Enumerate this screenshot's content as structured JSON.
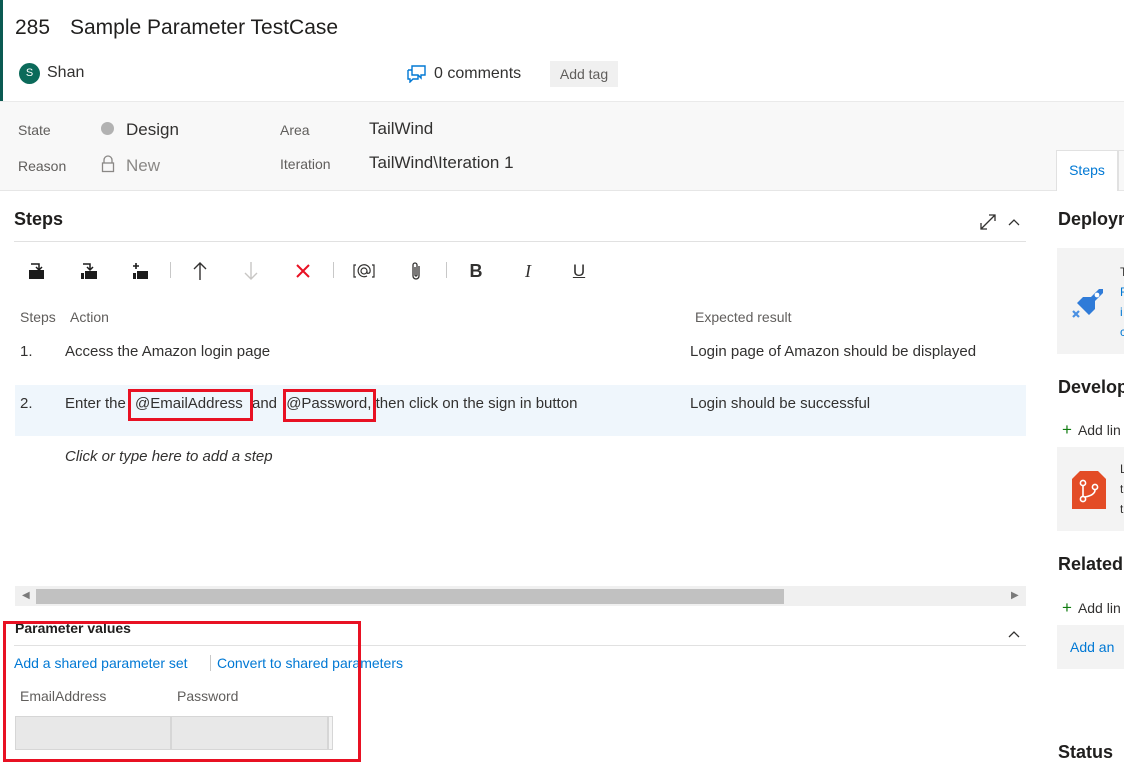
{
  "header": {
    "work_item_id": "285",
    "title": "Sample Parameter TestCase",
    "avatar_initial": "S",
    "assignee": "Shan",
    "comments": "0 comments",
    "add_tag": "Add tag"
  },
  "fields": {
    "state_label": "State",
    "state_value": "Design",
    "reason_label": "Reason",
    "reason_value": "New",
    "area_label": "Area",
    "area_value": "TailWind",
    "iteration_label": "Iteration",
    "iteration_value": "TailWind\\Iteration 1"
  },
  "right_tabs": {
    "active": "Steps"
  },
  "steps": {
    "title": "Steps",
    "columns": {
      "steps": "Steps",
      "action": "Action",
      "expected": "Expected result"
    },
    "rows": [
      {
        "num": "1.",
        "action": "Access the Amazon login page",
        "expected": "Login page of Amazon should be displayed"
      },
      {
        "num": "2.",
        "action_parts": [
          "Enter the ",
          "@EmailAddress",
          " and ",
          "@Password",
          ", then click on the sign in button"
        ],
        "expected": "Login should be successful"
      }
    ],
    "add_step_placeholder": "Click or type here to add a step"
  },
  "parameters": {
    "title": "Parameter values",
    "add_shared_link": "Add a shared parameter set",
    "convert_link": "Convert to shared parameters",
    "columns": [
      "EmailAddress",
      "Password"
    ]
  },
  "right_pane": {
    "deployment_title": "Deploym",
    "development_title": "Develop",
    "related_title": "Related",
    "status_title": "Status",
    "add_link_1": "Add lin",
    "add_link_2": "Add lin",
    "add_an": "Add an",
    "deploy_card_letters": [
      "T",
      "F",
      "i",
      "c"
    ],
    "dev_card_letters": [
      "L",
      "t",
      "t"
    ]
  },
  "colors": {
    "accent": "#0b5a52",
    "link": "#0078d4",
    "highlight": "#e81123",
    "selected_row": "#eff6fc"
  }
}
